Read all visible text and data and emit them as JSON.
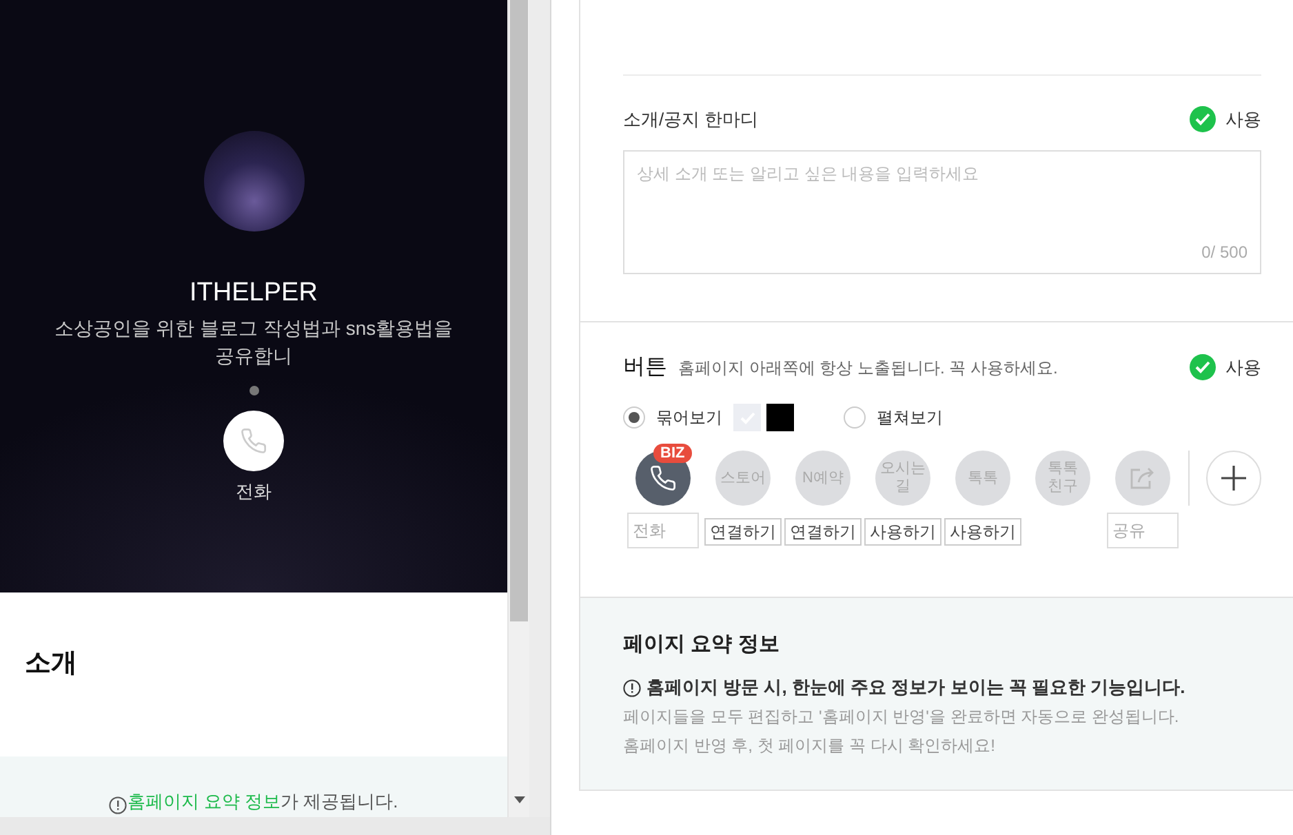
{
  "preview": {
    "title": "ITHELPER",
    "description": "소상공인을 위한 블로그 작성법과 sns활용법을 공유합니",
    "call_button": {
      "label": "전화"
    },
    "intro_heading": "소개",
    "summary_notice": {
      "link": "홈페이지 요약 정보",
      "text": "가 제공됩니다."
    }
  },
  "intro_notice": {
    "label": "소개/공지 한마디",
    "use": {
      "label": "사용",
      "checked": true
    },
    "placeholder": "상세 소개 또는 알리고 싶은 내용을 입력하세요",
    "counter": "0/ 500"
  },
  "buttons_section": {
    "title": "버튼",
    "hint": "홈페이지 아래쪽에 항상 노출됩니다. 꼭 사용하세요.",
    "use": {
      "label": "사용",
      "checked": true
    },
    "display_options": [
      {
        "label": "묶어보기",
        "selected": true
      },
      {
        "label": "펼쳐보기",
        "selected": false
      }
    ],
    "items": [
      {
        "kind": "phone",
        "active": true,
        "badge": "BIZ",
        "caption": {
          "kind": "field",
          "text": "전화"
        }
      },
      {
        "kind": "text",
        "label": "스토어",
        "active": false,
        "caption": {
          "kind": "callout",
          "text": "연결하기"
        }
      },
      {
        "kind": "text",
        "label": "N예약",
        "active": false,
        "caption": {
          "kind": "callout",
          "text": "연결하기"
        }
      },
      {
        "kind": "text",
        "label": "오시는길",
        "active": false,
        "caption": {
          "kind": "callout",
          "text": "사용하기"
        }
      },
      {
        "kind": "text",
        "label": "톡톡",
        "active": false,
        "caption": {
          "kind": "callout",
          "text": "사용하기"
        }
      },
      {
        "kind": "text",
        "label": "톡톡\n친구",
        "active": false
      },
      {
        "kind": "share",
        "active": false,
        "caption": {
          "kind": "field",
          "text": "공유"
        }
      }
    ]
  },
  "summary": {
    "title": "페이지 요약 정보",
    "lead": "홈페이지 방문 시, 한눈에 주요 정보가 보이는 꼭 필요한 기능입니다.",
    "lines": [
      "페이지들을 모두 편집하고 '홈페이지 반영'을 완료하면 자동으로 완성됩니다.",
      "홈페이지 반영 후, 첫 페이지를 꼭 다시 확인하세요!"
    ]
  }
}
